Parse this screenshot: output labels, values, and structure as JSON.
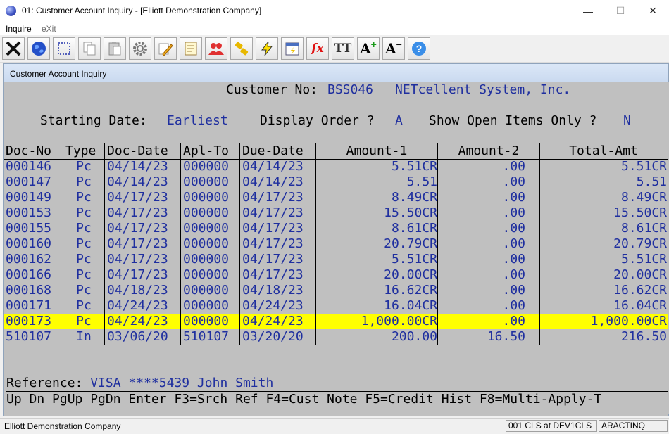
{
  "window": {
    "title": "01: Customer Account Inquiry - [Elliott Demonstration Company]",
    "minimize_glyph": "—",
    "maximize_glyph": "☐",
    "close_glyph": "✕"
  },
  "menu": {
    "inquire": "Inquire",
    "exit": "eXit"
  },
  "toolbar": {
    "buttons": [
      "close-x-icon",
      "globe-icon",
      "select-icon",
      "copy-icon",
      "paste-icon",
      "settings-gear-icon",
      "edit-pencil-icon",
      "notes-icon",
      "users-icon",
      "link-icon",
      "lightning-icon",
      "calendar-icon",
      "function-icon",
      "font-size-icon",
      "increase-font-icon",
      "decrease-font-icon",
      "help-icon"
    ],
    "fx_label": "fx",
    "tt_label": "TT",
    "a_plus_label": "A",
    "a_minus_label": "A"
  },
  "child_window": {
    "title": "Customer Account Inquiry"
  },
  "inquiry": {
    "customer_label": "Customer No:",
    "customer_no": "BSS046",
    "customer_name": "NETcellent System, Inc.",
    "starting_date_label": "Starting Date:",
    "starting_date": "Earliest",
    "display_order_label": "Display Order ?",
    "display_order": "A",
    "open_items_label": "Show Open Items Only ?",
    "open_items": "N"
  },
  "table": {
    "headers": [
      "Doc-No",
      "Type",
      "Doc-Date",
      "Apl-To",
      "Due-Date",
      "Amount-1",
      "Amount-2",
      "Total-Amt"
    ],
    "rows": [
      [
        "000146",
        "Pc",
        "04/14/23",
        "000000",
        "04/14/23",
        "5.51CR",
        ".00",
        "5.51CR"
      ],
      [
        "000147",
        "Pc",
        "04/14/23",
        "000000",
        "04/14/23",
        "5.51",
        ".00",
        "5.51"
      ],
      [
        "000149",
        "Pc",
        "04/17/23",
        "000000",
        "04/17/23",
        "8.49CR",
        ".00",
        "8.49CR"
      ],
      [
        "000153",
        "Pc",
        "04/17/23",
        "000000",
        "04/17/23",
        "15.50CR",
        ".00",
        "15.50CR"
      ],
      [
        "000155",
        "Pc",
        "04/17/23",
        "000000",
        "04/17/23",
        "8.61CR",
        ".00",
        "8.61CR"
      ],
      [
        "000160",
        "Pc",
        "04/17/23",
        "000000",
        "04/17/23",
        "20.79CR",
        ".00",
        "20.79CR"
      ],
      [
        "000162",
        "Pc",
        "04/17/23",
        "000000",
        "04/17/23",
        "5.51CR",
        ".00",
        "5.51CR"
      ],
      [
        "000166",
        "Pc",
        "04/17/23",
        "000000",
        "04/17/23",
        "20.00CR",
        ".00",
        "20.00CR"
      ],
      [
        "000168",
        "Pc",
        "04/18/23",
        "000000",
        "04/18/23",
        "16.62CR",
        ".00",
        "16.62CR"
      ],
      [
        "000171",
        "Pc",
        "04/24/23",
        "000000",
        "04/24/23",
        "16.04CR",
        ".00",
        "16.04CR"
      ],
      [
        "000173",
        "Pc",
        "04/24/23",
        "000000",
        "04/24/23",
        "1,000.00CR",
        ".00",
        "1,000.00CR"
      ],
      [
        "510107",
        "In",
        "03/06/20",
        "510107",
        "03/20/20",
        "200.00",
        "16.50",
        "216.50"
      ]
    ],
    "highlighted_row": 10
  },
  "reference": {
    "label": "Reference:",
    "value": "VISA ****5439 John Smith"
  },
  "function_keys": "Up Dn PgUp PgDn Enter F3=Srch Ref F4=Cust Note F5=Credit Hist F8=Multi-Apply-T",
  "status": {
    "company": "Elliott Demonstration Company",
    "session": "001 CLS at DEV1CLS",
    "program": "ARACTINQ"
  },
  "colors": {
    "terminal_bg": "#c0c0c0",
    "field_value": "#1f2f9f",
    "highlight": "#ffff00"
  }
}
